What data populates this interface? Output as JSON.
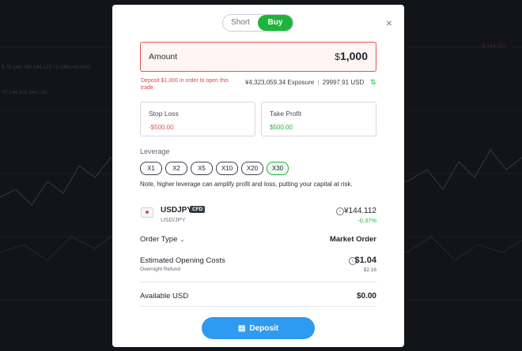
{
  "background": {
    "left_ticker_1": "5.70 144.285 144.122 +0.5441+0.20%)",
    "left_ticker_2": "77 144.103 144.142",
    "right_ticker": "$ 144.102"
  },
  "modal": {
    "side_toggle": {
      "options": [
        "Short",
        "Buy"
      ],
      "selected": "Buy"
    },
    "close_label": "×",
    "amount": {
      "label": "Amount",
      "currency": "$",
      "value": "1,000"
    },
    "error_text": "Deposit $1,000 in order to open this trade",
    "exposure": {
      "value": "¥4,323,059.34",
      "label": "Exposure",
      "separator": "|",
      "usd_value": "29997.91",
      "usd_label": "USD"
    },
    "stop_loss": {
      "label": "Stop Loss",
      "value": "-$500.00"
    },
    "take_profit": {
      "label": "Take Profit",
      "value": "$500.00"
    },
    "leverage": {
      "title": "Leverage",
      "options": [
        "X1",
        "X2",
        "X5",
        "X10",
        "X20",
        "X30"
      ],
      "selected": "X30",
      "note": "Note, higher leverage can amplify profit and loss, putting your capital at risk."
    },
    "instrument": {
      "symbol": "USDJPY",
      "badge": "CFD",
      "pair": "USD/JPY",
      "price": "¥144.112",
      "change": "-0.37%"
    },
    "order_type": {
      "label": "Order Type",
      "value": "Market Order"
    },
    "estimated": {
      "label": "Estimated Opening Costs",
      "sub_label": "Overnight Refund",
      "value": "$1.04",
      "sub_value": "$2.16"
    },
    "available": {
      "label": "Available USD",
      "value": "$0.00"
    },
    "deposit_label": "Deposit"
  },
  "colors": {
    "accent_green": "#1eb33a",
    "error_red": "#e0544f",
    "deposit_blue": "#2f9bf0"
  }
}
